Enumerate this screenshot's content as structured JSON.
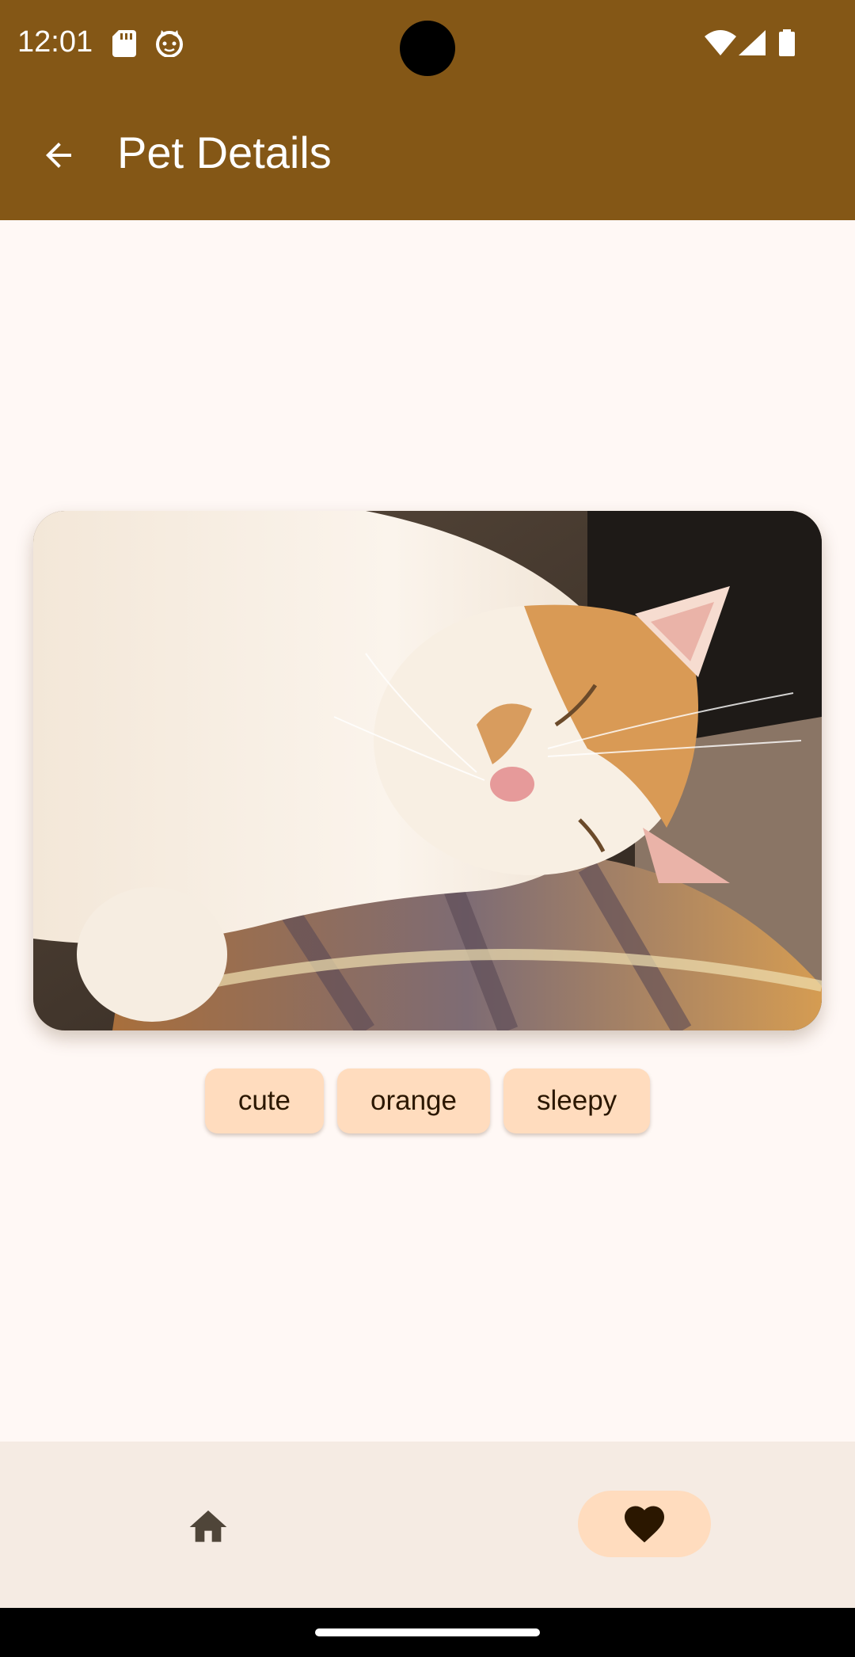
{
  "status_bar": {
    "time": "12:01",
    "icons": [
      "sd-card-icon",
      "cat-face-icon",
      "wifi-icon",
      "signal-icon",
      "battery-icon"
    ]
  },
  "app_bar": {
    "title": "Pet Details",
    "back_icon": "arrow-back-icon"
  },
  "pet": {
    "image_alt": "Sleeping orange and white cat on a plaid blanket",
    "tags": [
      "cute",
      "orange",
      "sleepy"
    ]
  },
  "bottom_nav": {
    "items": [
      {
        "icon": "home-icon",
        "selected": false
      },
      {
        "icon": "heart-icon",
        "selected": true
      }
    ]
  },
  "colors": {
    "primary": "#845716",
    "background": "#fff8f5",
    "chip": "#ffdcbe",
    "nav_background": "#f5ebe3"
  }
}
